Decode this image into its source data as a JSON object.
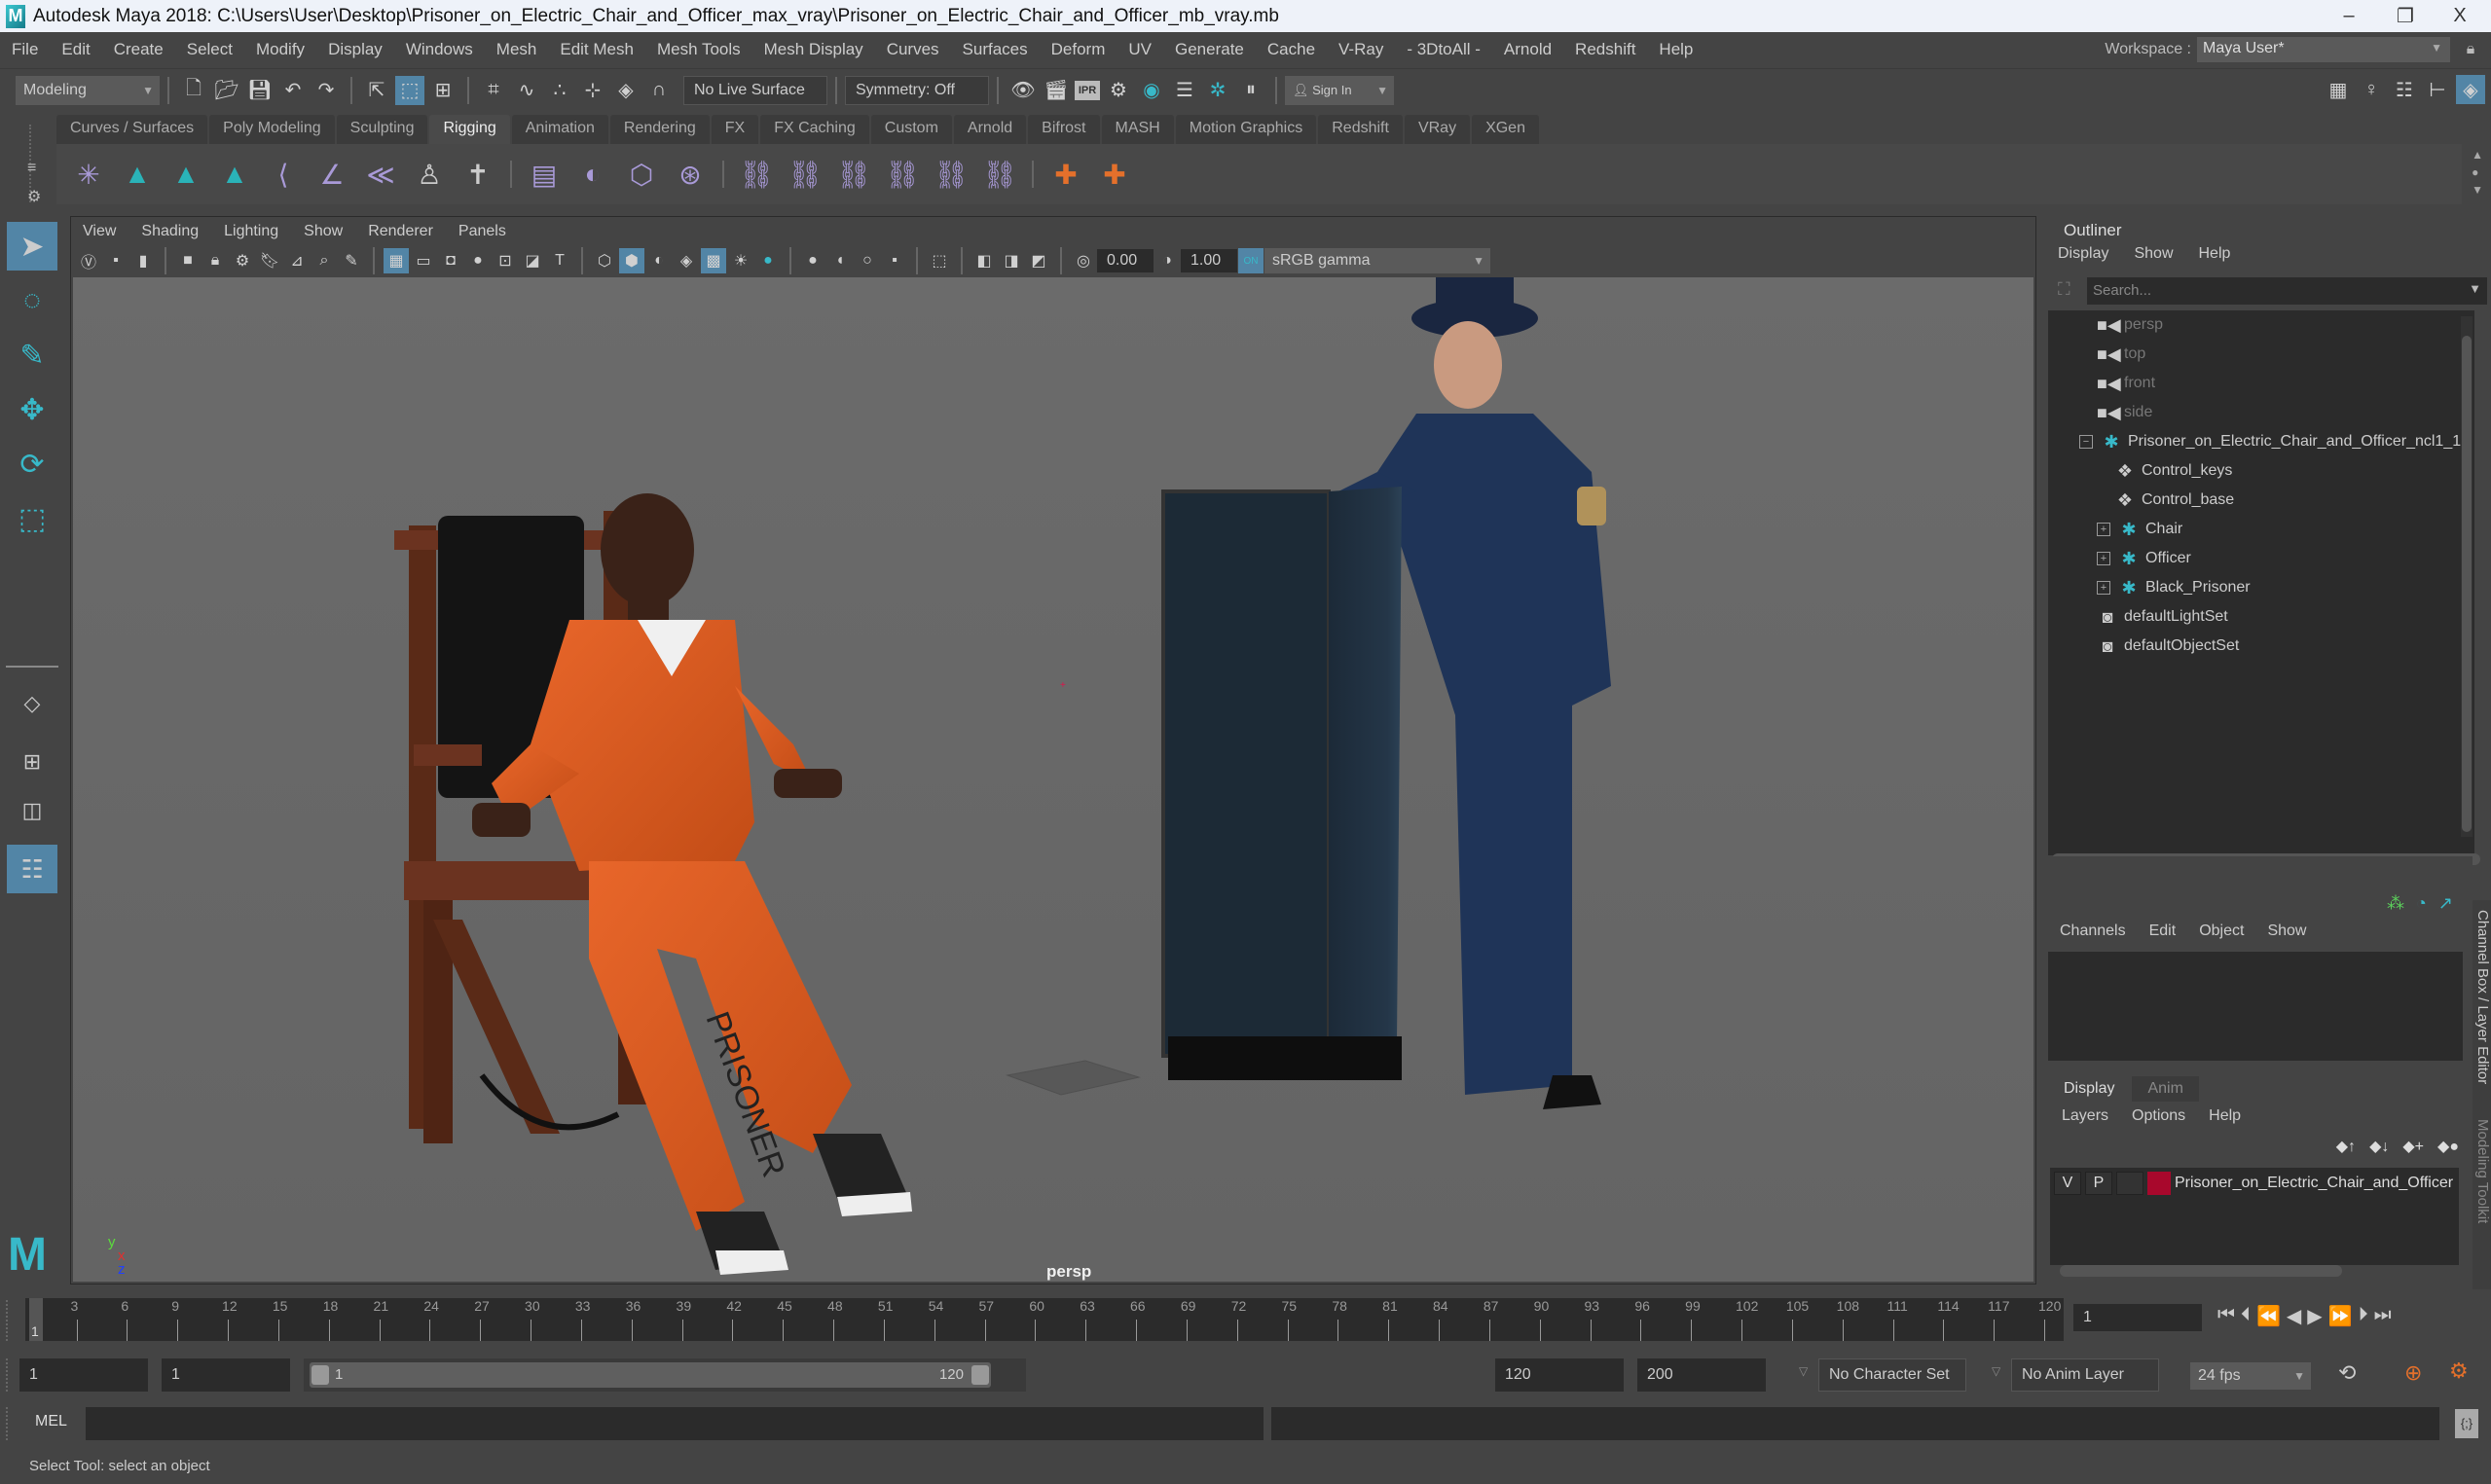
{
  "window": {
    "title": "Autodesk Maya 2018: C:\\Users\\User\\Desktop\\Prisoner_on_Electric_Chair_and_Officer_max_vray\\Prisoner_on_Electric_Chair_and_Officer_mb_vray.mb",
    "logo": "M",
    "controls": {
      "minimize": "–",
      "restore": "❐",
      "close": "X"
    }
  },
  "menubar": {
    "items": [
      "File",
      "Edit",
      "Create",
      "Select",
      "Modify",
      "Display",
      "Windows",
      "Mesh",
      "Edit Mesh",
      "Mesh Tools",
      "Mesh Display",
      "Curves",
      "Surfaces",
      "Deform",
      "UV",
      "Generate",
      "Cache",
      "V-Ray",
      "- 3DtoAll -",
      "Arnold",
      "Redshift",
      "Help"
    ],
    "workspace_label": "Workspace :",
    "workspace_value": "Maya User*"
  },
  "statusline": {
    "menuset": "Modeling",
    "live_surface": "No Live Surface",
    "symmetry": "Symmetry: Off",
    "sign_in": "Sign In",
    "ipr_label": "IPR"
  },
  "shelf": {
    "tabs": [
      "Curves / Surfaces",
      "Poly Modeling",
      "Sculpting",
      "Rigging",
      "Animation",
      "Rendering",
      "FX",
      "FX Caching",
      "Custom",
      "Arnold",
      "Bifrost",
      "MASH",
      "Motion Graphics",
      "Redshift",
      "VRay",
      "XGen"
    ],
    "active_tab": "Rigging"
  },
  "viewport": {
    "menu": [
      "View",
      "Shading",
      "Lighting",
      "Show",
      "Renderer",
      "Panels"
    ],
    "exposure": "0.00",
    "gamma": "1.00",
    "color_space": "sRGB gamma",
    "camera_label": "persp",
    "axis": {
      "y": "y",
      "z": "z",
      "x": "x"
    },
    "scene_text": "PRISONER"
  },
  "outliner": {
    "title": "Outliner",
    "menu": [
      "Display",
      "Show",
      "Help"
    ],
    "search_placeholder": "Search...",
    "items": [
      {
        "label": "persp",
        "icon": "camera-icon",
        "dim": true
      },
      {
        "label": "top",
        "icon": "camera-icon",
        "dim": true
      },
      {
        "label": "front",
        "icon": "camera-icon",
        "dim": true
      },
      {
        "label": "side",
        "icon": "camera-icon",
        "dim": true
      },
      {
        "label": "Prisoner_on_Electric_Chair_and_Officer_ncl1_1",
        "icon": "group-icon",
        "expander": "−"
      },
      {
        "label": "Control_keys",
        "icon": "locator-icon"
      },
      {
        "label": "Control_base",
        "icon": "locator-icon"
      },
      {
        "label": "Chair",
        "icon": "group-icon",
        "expander": "+"
      },
      {
        "label": "Officer",
        "icon": "group-icon",
        "expander": "+"
      },
      {
        "label": "Black_Prisoner",
        "icon": "group-icon",
        "expander": "+"
      },
      {
        "label": "defaultLightSet",
        "icon": "set-icon"
      },
      {
        "label": "defaultObjectSet",
        "icon": "set-icon"
      }
    ]
  },
  "channelbox": {
    "menu": [
      "Channels",
      "Edit",
      "Object",
      "Show"
    ],
    "side_tab": "Channel Box / Layer Editor",
    "side_tab2": "Modeling Toolkit"
  },
  "layereditor": {
    "tabs": [
      "Display",
      "Anim"
    ],
    "active_tab": "Display",
    "menu": [
      "Layers",
      "Options",
      "Help"
    ],
    "layers": [
      {
        "v": "V",
        "p": "P",
        "color": "#a8082c",
        "name": "Prisoner_on_Electric_Chair_and_Officer"
      }
    ]
  },
  "timeline": {
    "ticks": [
      3,
      6,
      9,
      12,
      15,
      18,
      21,
      24,
      27,
      30,
      33,
      36,
      39,
      42,
      45,
      48,
      51,
      54,
      57,
      60,
      63,
      66,
      69,
      72,
      75,
      78,
      81,
      84,
      87,
      90,
      93,
      96,
      99,
      102,
      105,
      108,
      111,
      114,
      117,
      120
    ],
    "range_start": 1,
    "range_end": 120,
    "current_frame": "1",
    "current_marker": "1"
  },
  "range": {
    "start": "1",
    "anim_start": "1",
    "slider_start": "1",
    "slider_end": "120",
    "anim_end": "120",
    "end": "200",
    "character_set": "No Character Set",
    "anim_layer": "No Anim Layer",
    "fps": "24 fps"
  },
  "mel": {
    "label": "MEL"
  },
  "status": {
    "help_line": "Select Tool: select an object"
  },
  "colors": {
    "accent": "#5285a6",
    "teal": "#38b9c9",
    "orange": "#e4702b"
  }
}
